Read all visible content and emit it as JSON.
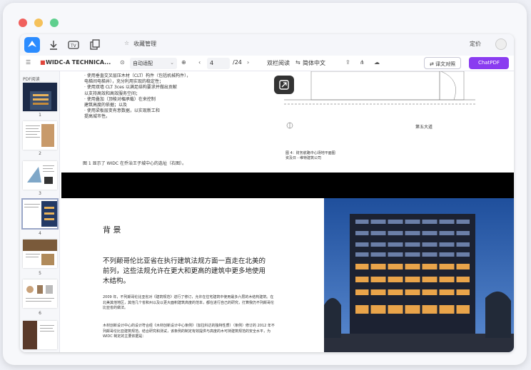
{
  "colors": {
    "dot_red": "#f0605d",
    "dot_yellow": "#f5c15a",
    "dot_green": "#5fcf8e",
    "accent_purple": "#8a3cf0",
    "logo_blue": "#2b8cff"
  },
  "topbar": {
    "favorites": "收藏管理",
    "pricing": "定价"
  },
  "toolbar": {
    "file_name": "WIDC-A TECHNICA...",
    "zoom": "自动适配",
    "page_current": "4",
    "page_total": "/24",
    "mode": "双栏阅读",
    "language": "简体中文",
    "compare": "⇄ 译文对照",
    "chatpdf": "ChatPDF"
  },
  "sidebar": {
    "title": "PDF阅读",
    "pages": [
      "1",
      "2",
      "3",
      "4",
      "5",
      "6"
    ]
  },
  "doc": {
    "bullets": [
      "· 使用垂直交叉层压木材（CLT）构件（包括机械构件），",
      "   电梯间电梯井），充分利用实现的稳定性；",
      "· 使用双墙 CLT 3ces 以满足结构要求并做出贡献",
      "   以支持高效和高效服务空间；",
      "· 使用叠加（顶棱对楣承载）在来控制",
      "   建筑高度的依据；以及",
      "· 使用梁板层变有意数据，以实现新工和",
      "   提高城市性。"
    ],
    "caption1": "图 1 显示了 WIDC 在乔治王子城中心的选址（右图）。",
    "street": "第五大道",
    "fig_caption_1": "图 4：财务航路中心场地平面图",
    "fig_caption_2": "资及日 - 维特建筑公司",
    "heading": "背 景",
    "lead": "不列颠哥伦比亚省在执行建筑法规方面一直走在北美的前列，这些法规允许在更大和更高的建筑中更多地使用木结构。",
    "para1": "2009 年，不列颠哥伦比亚省对《建筑规范》进行了修订，允许在住宅建筑中使用最多六层的木结构建筑。在北美其他地区，其他几个省和州以及以更大面积建筑高度的范本，都在进行自己的研究，打算我仍不列颠哥伦比亚省的做法。",
    "para2": "木材创新设计中心的设计符合经《木材创新设计中心条例》（加拉科达的独特性质）（条例）修订的 2012 年不列颠哥伦比亚建筑规范。结合研究和测试，该条例的制定有效提供与高度的木可持建筑规范的安全水平，为 WIDC 制定的主要依据是："
  }
}
